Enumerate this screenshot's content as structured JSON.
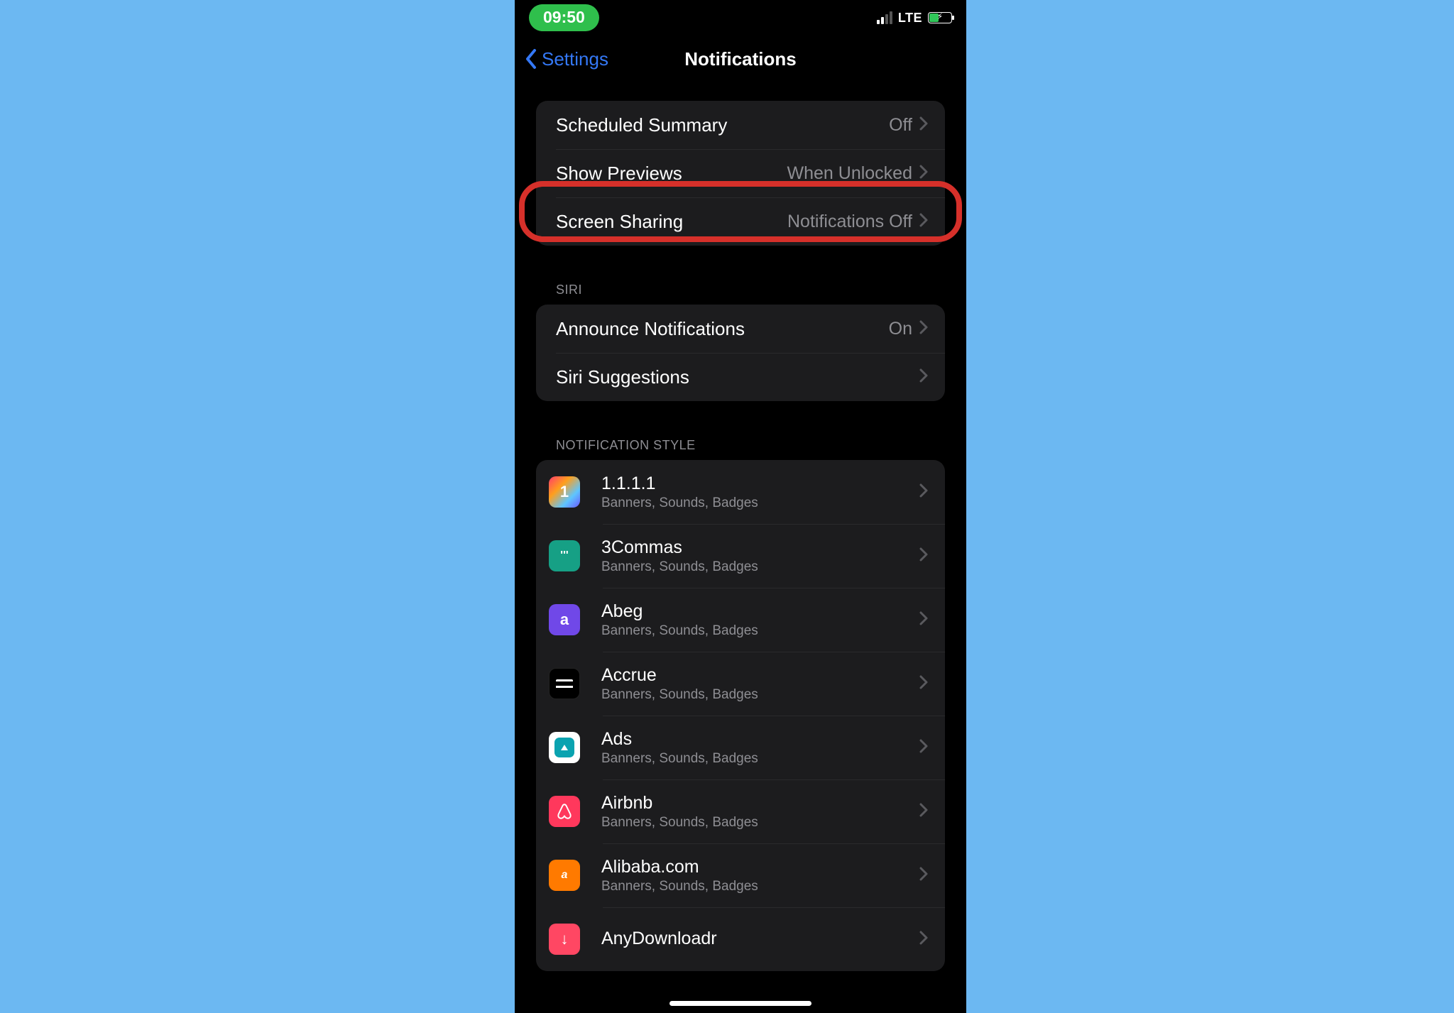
{
  "status": {
    "time": "09:50",
    "network": "LTE"
  },
  "navbar": {
    "back": "Settings",
    "title": "Notifications"
  },
  "group1": {
    "items": [
      {
        "label": "Scheduled Summary",
        "value": "Off"
      },
      {
        "label": "Show Previews",
        "value": "When Unlocked",
        "highlighted": true
      },
      {
        "label": "Screen Sharing",
        "value": "Notifications Off"
      }
    ]
  },
  "group2": {
    "header": "SIRI",
    "items": [
      {
        "label": "Announce Notifications",
        "value": "On"
      },
      {
        "label": "Siri Suggestions",
        "value": ""
      }
    ]
  },
  "group3": {
    "header": "NOTIFICATION STYLE",
    "apps": [
      {
        "name": "1.1.1.1",
        "sub": "Banners, Sounds, Badges",
        "icon_class": "ic-1111",
        "glyph": "1"
      },
      {
        "name": "3Commas",
        "sub": "Banners, Sounds, Badges",
        "icon_class": "ic-3commas",
        "glyph": "'''"
      },
      {
        "name": "Abeg",
        "sub": "Banners, Sounds, Badges",
        "icon_class": "ic-abeg",
        "glyph": "a"
      },
      {
        "name": "Accrue",
        "sub": "Banners, Sounds, Badges",
        "icon_class": "ic-accrue",
        "glyph": ""
      },
      {
        "name": "Ads",
        "sub": "Banners, Sounds, Badges",
        "icon_class": "ic-ads",
        "glyph": ""
      },
      {
        "name": "Airbnb",
        "sub": "Banners, Sounds, Badges",
        "icon_class": "ic-airbnb",
        "glyph": ""
      },
      {
        "name": "Alibaba.com",
        "sub": "Banners, Sounds, Badges",
        "icon_class": "ic-alibaba",
        "glyph": "a"
      },
      {
        "name": "AnyDownloadr",
        "sub": "",
        "icon_class": "ic-anydownloadr",
        "glyph": "↓"
      }
    ]
  }
}
